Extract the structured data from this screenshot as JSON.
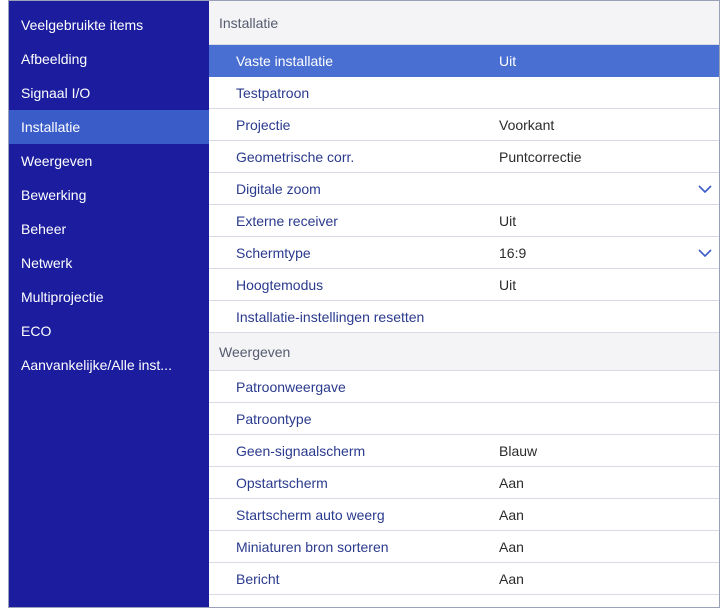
{
  "sidebar": {
    "items": [
      {
        "label": "Veelgebruikte items"
      },
      {
        "label": "Afbeelding"
      },
      {
        "label": "Signaal I/O"
      },
      {
        "label": "Installatie"
      },
      {
        "label": "Weergeven"
      },
      {
        "label": "Bewerking"
      },
      {
        "label": "Beheer"
      },
      {
        "label": "Netwerk"
      },
      {
        "label": "Multiprojectie"
      },
      {
        "label": "ECO"
      },
      {
        "label": "Aanvankelijke/Alle inst..."
      }
    ],
    "active_index": 3
  },
  "main": {
    "installatie": {
      "header": "Installatie",
      "rows": [
        {
          "label": "Vaste installatie",
          "value": "Uit"
        },
        {
          "label": "Testpatroon",
          "value": ""
        },
        {
          "label": "Projectie",
          "value": "Voorkant"
        },
        {
          "label": "Geometrische corr.",
          "value": "Puntcorrectie"
        },
        {
          "label": "Digitale zoom",
          "value": "",
          "icon": "chevron-down-icon"
        },
        {
          "label": "Externe receiver",
          "value": "Uit"
        },
        {
          "label": "Schermtype",
          "value": "16:9",
          "icon": "chevron-down-icon"
        },
        {
          "label": "Hoogtemodus",
          "value": "Uit"
        },
        {
          "label": "Installatie-instellingen resetten",
          "value": ""
        }
      ]
    },
    "weergeven": {
      "header": "Weergeven",
      "rows": [
        {
          "label": "Patroonweergave",
          "value": ""
        },
        {
          "label": "Patroontype",
          "value": ""
        },
        {
          "label": "Geen-signaalscherm",
          "value": "Blauw"
        },
        {
          "label": "Opstartscherm",
          "value": "Aan"
        },
        {
          "label": "Startscherm auto weerg",
          "value": "Aan"
        },
        {
          "label": "Miniaturen bron sorteren",
          "value": "Aan"
        },
        {
          "label": "Bericht",
          "value": "Aan"
        }
      ]
    }
  },
  "colors": {
    "sidebar_bg": "#1b1d9e",
    "sidebar_active": "#3a5cc9",
    "row_selected": "#4a6fd3",
    "row_text": "#2a3a8e"
  }
}
